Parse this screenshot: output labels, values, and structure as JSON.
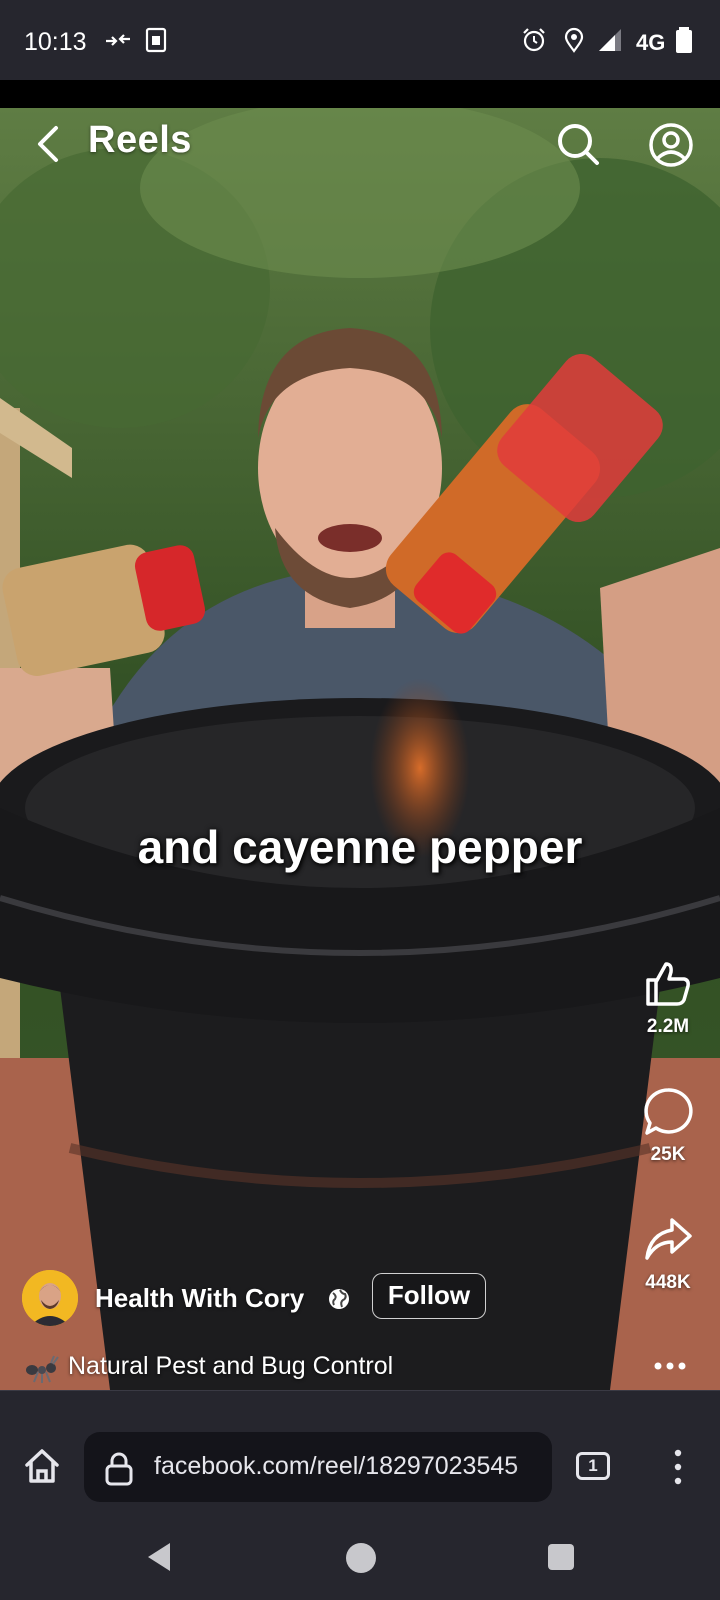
{
  "status_bar": {
    "time": "10:13",
    "network": "4G",
    "icons": [
      "data-transfer-icon",
      "sim-card-icon",
      "alarm-icon",
      "location-icon",
      "signal-icon",
      "battery-icon"
    ]
  },
  "header": {
    "title": "Reels"
  },
  "video": {
    "caption": "and cayenne pepper"
  },
  "actions": {
    "likes": "2.2M",
    "comments": "25K",
    "shares": "448K"
  },
  "author": {
    "name": "Health With Cory",
    "follow_label": "Follow"
  },
  "reel": {
    "description": "Natural Pest and Bug Control"
  },
  "browser": {
    "url": "facebook.com/reel/18297023545",
    "tab_count": "1"
  },
  "colors": {
    "bar_background": "#26262e",
    "url_field": "#14141a"
  }
}
